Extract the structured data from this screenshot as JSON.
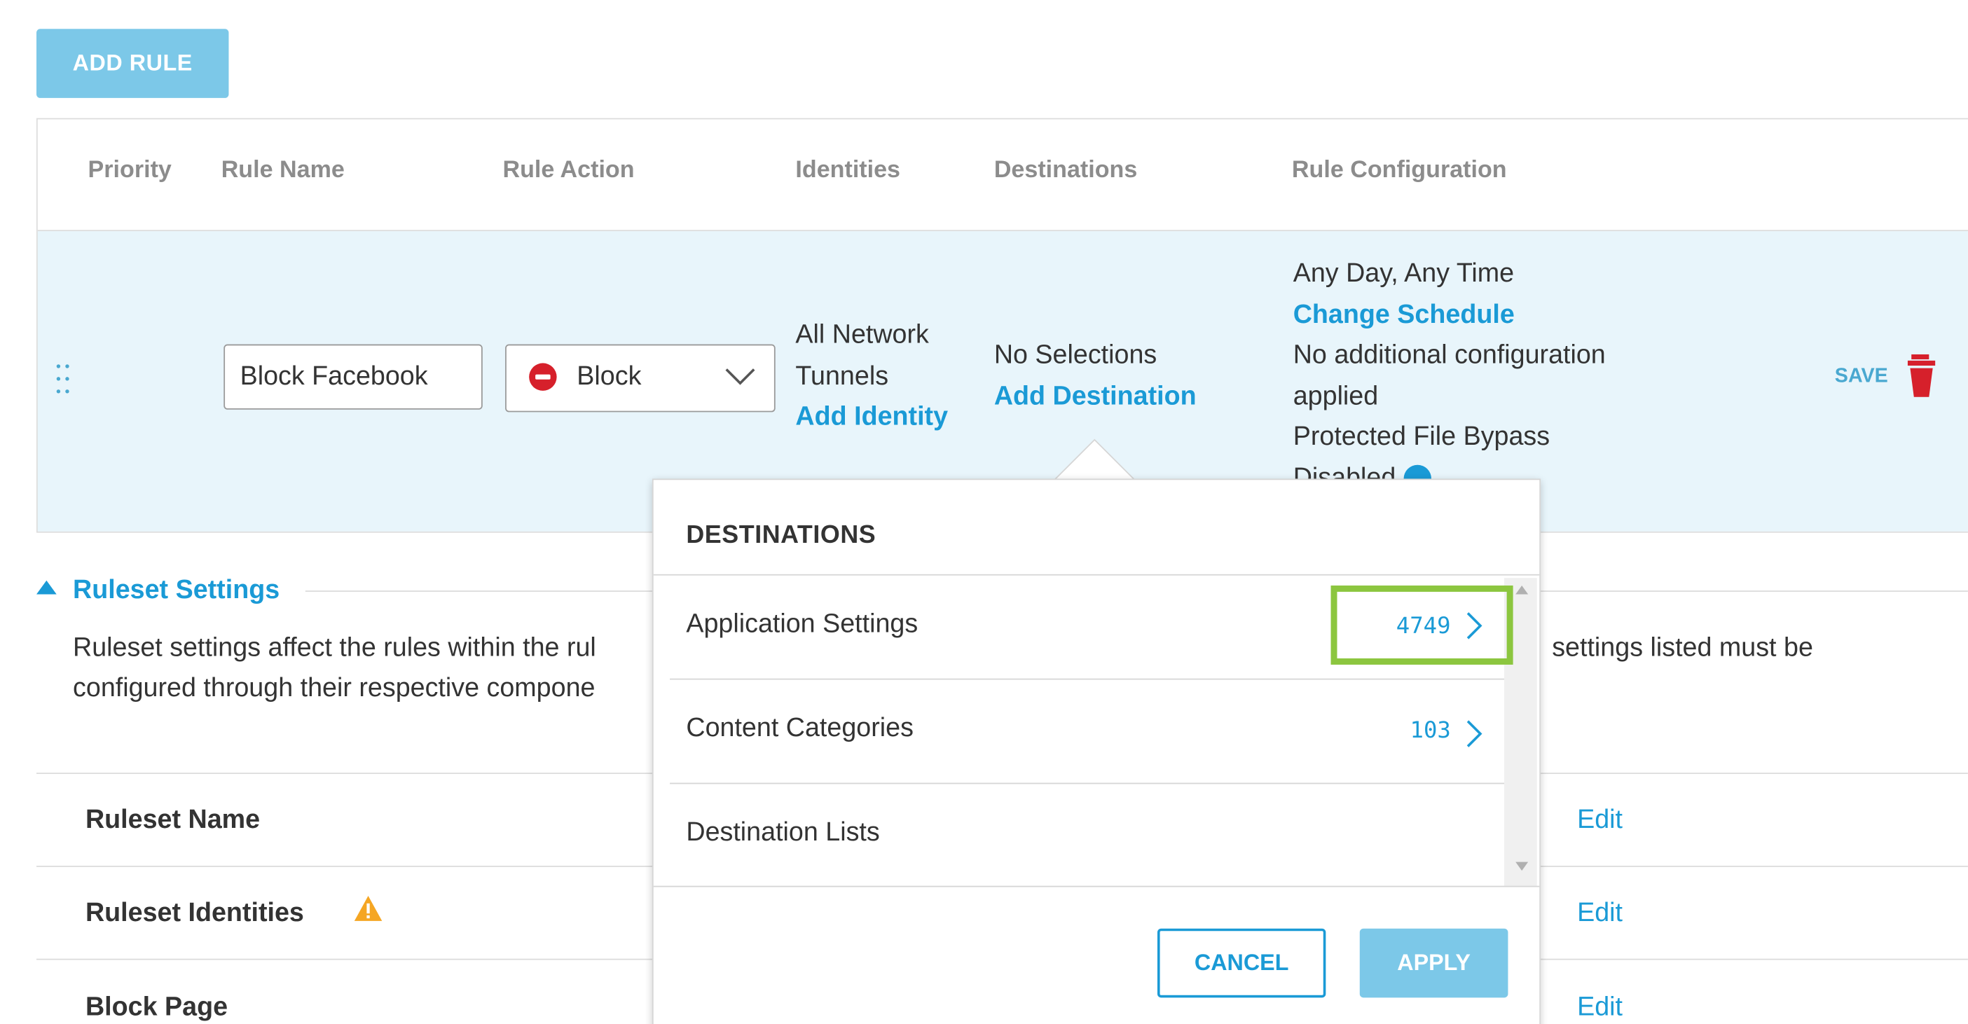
{
  "toolbar": {
    "add_rule_label": "ADD RULE"
  },
  "table": {
    "headers": {
      "priority": "Priority",
      "rule_name": "Rule Name",
      "rule_action": "Rule Action",
      "identities": "Identities",
      "destinations": "Destinations",
      "rule_configuration": "Rule Configuration"
    },
    "row": {
      "rule_name_value": "Block Facebook",
      "rule_action_value": "Block",
      "identities_line1": "All Network",
      "identities_line2": "Tunnels",
      "add_identity_label": "Add Identity",
      "destinations_value": "No Selections",
      "add_destination_label": "Add Destination",
      "schedule_text": "Any Day, Any Time",
      "change_schedule_label": "Change Schedule",
      "config_line1": "No additional configuration",
      "config_line2": "applied",
      "bypass_line": "Protected File Bypass",
      "bypass_status": "Disabled",
      "save_label": "SAVE"
    }
  },
  "ruleset": {
    "title": "Ruleset Settings",
    "description_line1_left": "Ruleset settings affect the rules within the rul",
    "description_line1_right": "settings listed must be",
    "description_line2_left": "configured through their respective compone",
    "rows": [
      {
        "label": "Ruleset Name",
        "edit": "Edit"
      },
      {
        "label": "Ruleset Identities",
        "edit": "Edit"
      },
      {
        "label": "Block Page",
        "edit": "Edit"
      }
    ]
  },
  "popover": {
    "title": "DESTINATIONS",
    "items": [
      {
        "label": "Application Settings",
        "count": "4749"
      },
      {
        "label": "Content Categories",
        "count": "103"
      },
      {
        "label": "Destination Lists",
        "count": ""
      }
    ],
    "cancel_label": "CANCEL",
    "apply_label": "APPLY"
  },
  "icons": {
    "drag": "drag-handle-icon",
    "block": "block-icon",
    "dropdown": "chevron-down-icon",
    "trash": "trash-icon",
    "info": "info-icon",
    "warning": "warning-icon",
    "collapse": "triangle-up-icon",
    "next": "chevron-right-icon"
  },
  "colors": {
    "accent": "#1a9ad6",
    "button_light": "#7cc8e8",
    "row_highlight": "#e8f5fb",
    "block_red": "#d6202b",
    "warning": "#f5a623",
    "highlight_green": "#8cc63f"
  }
}
